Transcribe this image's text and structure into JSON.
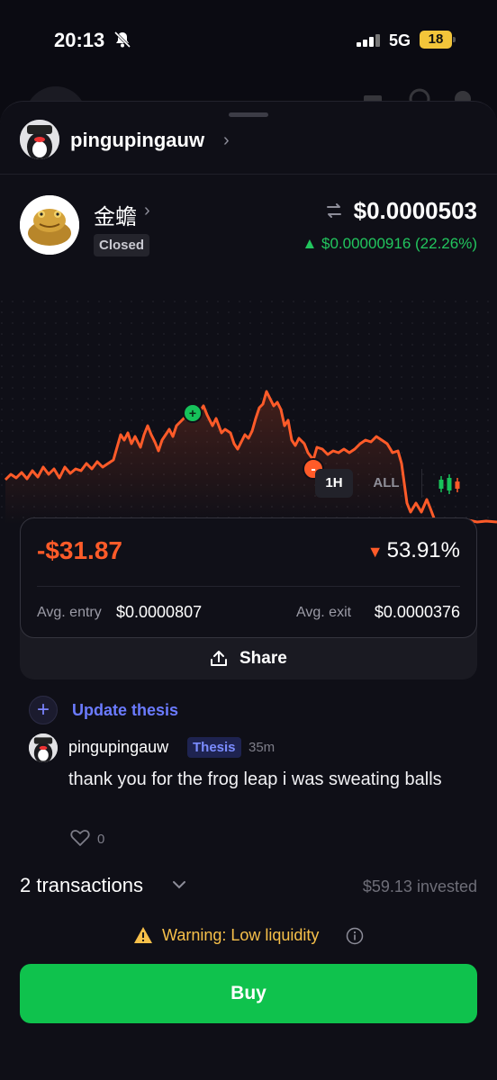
{
  "status_bar": {
    "time": "20:13",
    "network": "5G",
    "battery": "18"
  },
  "profile": {
    "username": "pingupingauw"
  },
  "token": {
    "name": "金蟾",
    "status": "Closed",
    "price": "$0.0000503",
    "change": "▲ $0.00000916 (22.26%)",
    "change_color": "#22c55e"
  },
  "chart": {
    "line_color": "#ff5b29",
    "buy_marker": "+",
    "sell_marker": "-"
  },
  "ranges": {
    "one_hour": "1H",
    "all": "ALL"
  },
  "position": {
    "pnl": "-$31.87",
    "pnl_pct": "53.91%",
    "pnl_color": "#ff5b29",
    "avg_entry_label": "Avg. entry",
    "avg_entry_value": "$0.0000807",
    "avg_exit_label": "Avg. exit",
    "avg_exit_value": "$0.0000376",
    "share_label": "Share"
  },
  "thesis": {
    "update_label": "Update thesis"
  },
  "comment": {
    "username": "pingupingauw",
    "tag": "Thesis",
    "time": "35m",
    "text": "thank you for the frog leap i was sweating balls",
    "likes": "0"
  },
  "transactions": {
    "label": "2 transactions",
    "invested": "$59.13 invested"
  },
  "warning": {
    "text": "Warning: Low liquidity"
  },
  "buy": {
    "label": "Buy",
    "color": "#0fc24d"
  }
}
